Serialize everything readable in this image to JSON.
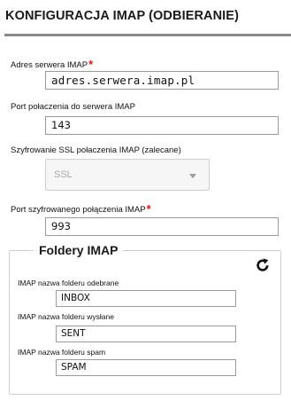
{
  "header": {
    "title": "KONFIGURACJA IMAP (ODBIERANIE)"
  },
  "server_address": {
    "label": "Adres serwera IMAP",
    "required_mark": "*",
    "value": "adres.serwera.imap.pl"
  },
  "port": {
    "label": "Port połaczenia do serwera IMAP",
    "value": "143"
  },
  "ssl": {
    "label": "Szyfrowanie SSL połaczenia IMAP (zalecane)",
    "selected": "SSL"
  },
  "ssl_port": {
    "label": "Port szyfrowanego połączenia IMAP",
    "required_mark": "*",
    "value": "993"
  },
  "folders": {
    "legend": "Foldery IMAP",
    "refresh_icon": "refresh-icon",
    "inbox": {
      "label": "IMAP nazwa folderu odebrane",
      "value": "INBOX"
    },
    "sent": {
      "label": "IMAP nazwa folderu wysłane",
      "value": "SENT"
    },
    "spam": {
      "label": "IMAP nazwa folderu spam",
      "value": "SPAM"
    }
  },
  "colors": {
    "required": "#e0141e",
    "rule": "#8a8a8a",
    "border": "#9a9a9a",
    "disabled_text": "#a8a8a8"
  }
}
